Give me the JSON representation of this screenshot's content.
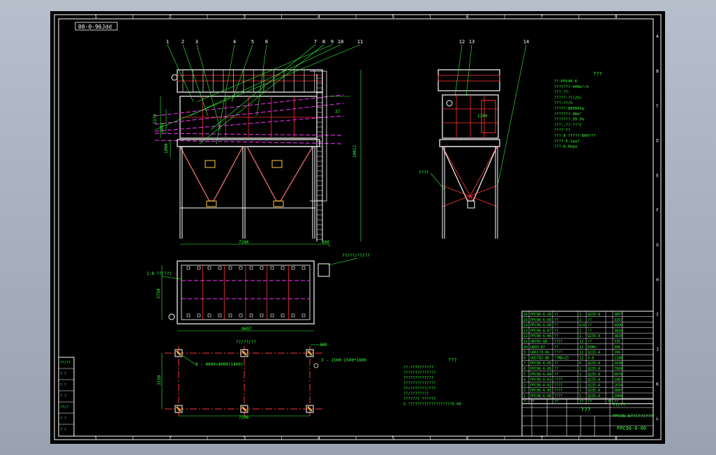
{
  "drawing": {
    "file_tag": "00-0-96Jdd",
    "grid_cols": [
      "1",
      "2",
      "3",
      "4",
      "5",
      "6",
      "7",
      "8"
    ],
    "grid_rows": [
      "A",
      "B",
      "C",
      "D",
      "E",
      "F",
      "G",
      "H",
      "I",
      "J",
      "K",
      "L"
    ],
    "front_leaders": [
      "1",
      "2",
      "3",
      "4",
      "5",
      "6",
      "7",
      "8",
      "9",
      "10",
      "11"
    ],
    "side_leaders": [
      "12",
      "13",
      "14"
    ],
    "dims": {
      "front_width": "7206",
      "front_right": "800",
      "front_height": "10011",
      "front_h1": "2370",
      "front_h2": "2882",
      "front_h3": "1000",
      "plan_width": "9697",
      "plan_depth": "2750",
      "foot_width": "7206",
      "foot_depth": "3150",
      "foot_offset": "300",
      "side_dim": "1100",
      "inlet_label": "37"
    },
    "labels": {
      "plan_left_tag": "1:8 ??(??)",
      "plan_right_tag": "??/??/??/??",
      "foot_title": "??/??/??",
      "foot_bolt_1": "8 - 4000×4000(1400)",
      "foot_bolt_2": "3 - 1500 1500*1800",
      "side_tag": "????",
      "tech_title": "???",
      "notes_title": "???"
    },
    "tech_specs": [
      "??:PPC96-6",
      "???????:400m³/h",
      "??? ??:",
      "?????:??(2%)",
      "???:??/h",
      "?????:80000kg",
      "???????:96m²",
      "???????:99.9%",
      "???:,??:??°C",
      "????:??",
      "???:8 ?????:800???",
      "????:5.1pa?",
      "???:0.6mpa"
    ],
    "notes": [
      "??:??????????",
      "??????????????",
      "?????????????",
      "??????????????",
      "??/???????/???",
      "??/????????",
      "??????? ??????",
      "5.???????????????????0.00"
    ],
    "bom_rows": [
      [
        "16",
        "PPC96-6-10",
        "??",
        "1",
        "Q235-A",
        "",
        "3857"
      ],
      [
        "15",
        "PPC96-6-09",
        "??",
        "2",
        "??",
        "",
        "3357"
      ],
      [
        "14",
        "PPC96-6-08",
        "??",
        "8/6",
        "??",
        "",
        "4800"
      ],
      [
        "13",
        "PPC96-6-07",
        "??",
        "1",
        "??",
        "",
        "3850"
      ],
      [
        "12",
        "PPC96-6-06",
        "??",
        "1",
        "Q235-A",
        "",
        "3820"
      ],
      [
        "11",
        "GB795-88",
        "????",
        "12",
        "??",
        "",
        "335"
      ],
      [
        "10",
        "GB93-87",
        "??",
        "12",
        "65Mn",
        "",
        "396"
      ],
      [
        "9",
        "GB6170-86",
        "????",
        "12",
        "Q235-A",
        "",
        "396"
      ],
      [
        "8",
        "GB5783-86",
        "??M8×25",
        "12",
        "4.8",
        "",
        "1188"
      ],
      [
        "7",
        "PPC96-6-05",
        "??",
        "6",
        "Q235-A",
        "",
        "1038"
      ],
      [
        "6",
        "PPC96-6-05",
        "??",
        "1",
        "Q235-A",
        "",
        "7009"
      ],
      [
        "5",
        "PPC96-6-04",
        "??",
        "1",
        "Q235-A",
        "",
        "6078"
      ],
      [
        "4",
        "PPC96-6-03",
        "????",
        "1",
        "Q235-A",
        "",
        "1883"
      ],
      [
        "3",
        "PPC96-6-02",
        "????",
        "1",
        "Q235-A",
        "",
        "2034"
      ],
      [
        "2",
        "PPC96-6-01",
        "????",
        "1",
        "Q235-A",
        "",
        "3807"
      ],
      [
        "1",
        "PPC96-6-00",
        "????",
        "1",
        "Q235-A",
        "",
        "2000"
      ]
    ],
    "bom_header": [
      "?",
      "??",
      "??",
      "??",
      "??",
      "??",
      "??"
    ],
    "title_block": {
      "name": "???",
      "drawing_no": "PPC96-6-00",
      "full_name": "PPC96-6??(??)???",
      "company": "??/??"
    },
    "left_table_rows": [
      "??/??",
      "? ?",
      "? ?",
      "? ?",
      "??/?",
      "? ?",
      "? ?"
    ]
  }
}
